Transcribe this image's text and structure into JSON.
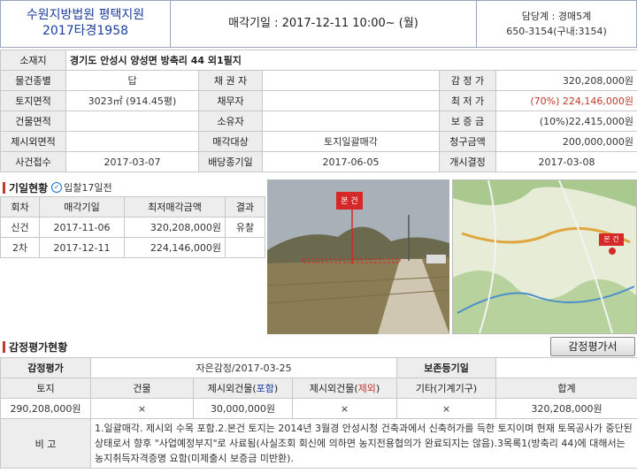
{
  "header": {
    "court": "수원지방법원 평택지원",
    "case_no": "2017타경1958",
    "auction_date": "매각기일 : 2017-12-11   10:00~ (월)",
    "dept": "담당계 : 경매5계",
    "phone": "650-3154(구내:3154)"
  },
  "info": {
    "address_label": "소재지",
    "address": "경기도 안성시 양성면 방축리 44 외1필지",
    "rows": [
      {
        "l1": "물건종별",
        "v1": "답",
        "l2": "채 권 자",
        "v2": "",
        "l3": "감 정 가",
        "v3": "320,208,000원"
      },
      {
        "l1": "토지면적",
        "v1": "3023㎡ (914.45평)",
        "l2": "채무자",
        "v2": "",
        "l3": "최 저 가",
        "v3": "(70%) 224,146,000원"
      },
      {
        "l1": "건물면적",
        "v1": "",
        "l2": "소유자",
        "v2": "",
        "l3": "보 증 금",
        "v3": "(10%)22,415,000원"
      },
      {
        "l1": "제시외면적",
        "v1": "",
        "l2": "매각대상",
        "v2": "토지일괄매각",
        "l3": "청구금액",
        "v3": "200,000,000원"
      },
      {
        "l1": "사건접수",
        "v1": "2017-03-07",
        "l2": "배당종기일",
        "v2": "2017-06-05",
        "l3": "개시결정",
        "v3": "2017-03-08"
      }
    ]
  },
  "history": {
    "title": "기일현황",
    "bid_note": "입찰17일전",
    "headers": [
      "회차",
      "매각기일",
      "최저매각금액",
      "결과"
    ],
    "rows": [
      {
        "round": "신건",
        "date": "2017-11-06",
        "price": "320,208,000원",
        "result": "유찰"
      },
      {
        "round": "2차",
        "date": "2017-12-11",
        "price": "224,146,000원",
        "result": ""
      }
    ]
  },
  "photo": {
    "tag": "본 건"
  },
  "map": {
    "tag": "본 건"
  },
  "appraisal": {
    "title": "감정평가현황",
    "button": "감정평가서",
    "row1": {
      "label": "감정평가",
      "value": "자은감정/2017-03-25",
      "label2": "보존등기일",
      "value2": ""
    },
    "headers": {
      "land": "토지",
      "building": "건물",
      "extra_in_pre": "제시외건물(",
      "extra_in_hl": "포함",
      "extra_out_pre": "제시외건물(",
      "extra_out_hl": "제외",
      "close": ")",
      "other": "기타(기계기구)",
      "total": "합계"
    },
    "values": {
      "land": "290,208,000원",
      "building": "×",
      "extra_in": "30,000,000원",
      "extra_out": "×",
      "other": "×",
      "total": "320,208,000원"
    },
    "remark_label": "비 고",
    "remark": "1.일괄매각. 제시외 수목 포함.2.본건 토지는 2014년 3월경 안성시청 건축과에서 신축허가를 득한 토지이며 현재 토목공사가 중단된 상태로서 향후 \"사업예정부지\"로 사료됨(사실조회 회신에 의하면 농지전용협의가 완료되지는 않음).3목록1(방축리 44)에 대해서는 농지취득자격증명 요함(미제출시 보증금 미반환)."
  },
  "colors": {
    "accent_blue": "#1a3d9e",
    "accent_red": "#c0392b",
    "label_bg": "#ededed"
  }
}
